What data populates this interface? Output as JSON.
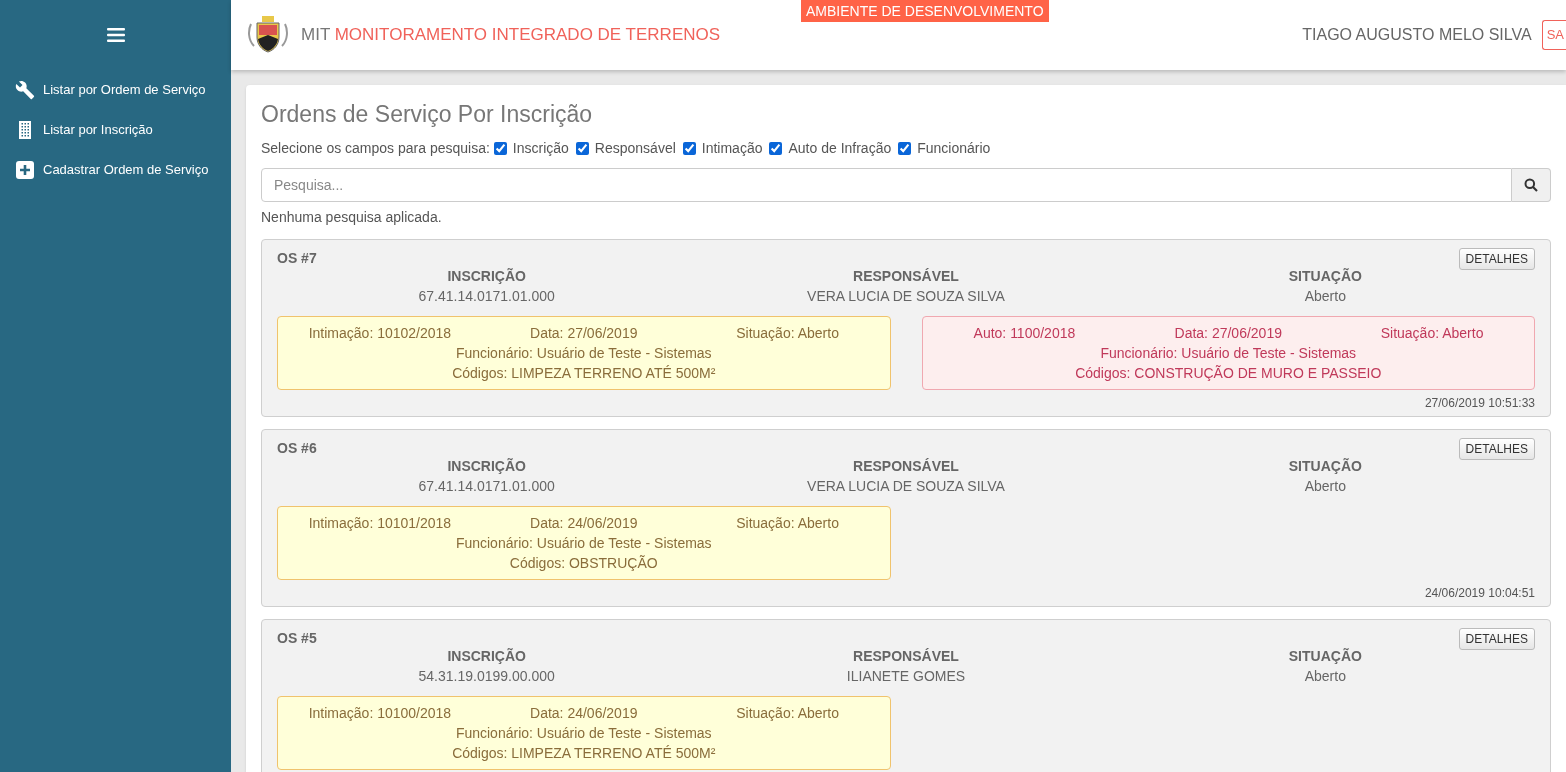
{
  "sidebar": {
    "items": [
      {
        "label": "Listar por Ordem de Serviço",
        "kind": "wrench"
      },
      {
        "label": "Listar por Inscrição",
        "kind": "building"
      },
      {
        "label": "Cadastrar Ordem de Serviço",
        "kind": "plus"
      }
    ]
  },
  "header": {
    "app_short": "MIT",
    "app_name": "MONITORAMENTO INTEGRADO DE TERRENOS",
    "environment": "AMBIENTE DE DESENVOLVIMENTO",
    "user": "TIAGO AUGUSTO MELO SILVA",
    "logout": "SA"
  },
  "page": {
    "title": "Ordens de Serviço Por Inscrição",
    "fields_label": "Selecione os campos para pesquisa:",
    "fields": [
      {
        "label": "Inscrição",
        "checked": true
      },
      {
        "label": "Responsável",
        "checked": true
      },
      {
        "label": "Intimação",
        "checked": true
      },
      {
        "label": "Auto de Infração",
        "checked": true
      },
      {
        "label": "Funcionário",
        "checked": true
      }
    ],
    "search": {
      "placeholder": "Pesquisa..."
    },
    "status": "Nenhuma pesquisa aplicada."
  },
  "orders": [
    {
      "title": "OS #7",
      "button": "DETALHES",
      "columns": [
        {
          "label": "INSCRIÇÃO",
          "value": "67.41.14.0171.01.000"
        },
        {
          "label": "RESPONSÁVEL",
          "value": "VERA LUCIA DE SOUZA SILVA"
        },
        {
          "label": "SITUAÇÃO",
          "value": "Aberto"
        }
      ],
      "notices": [
        {
          "kind": "intimacao",
          "number": "Intimação: 10102/2018",
          "date": "Data: 27/06/2019",
          "status": "Situação: Aberto",
          "employee": "Funcionário: Usuário de Teste - Sistemas",
          "codes": "Códigos: LIMPEZA TERRENO ATÉ 500M²"
        },
        {
          "kind": "auto",
          "number": "Auto: 1100/2018",
          "date": "Data: 27/06/2019",
          "status": "Situação: Aberto",
          "employee": "Funcionário: Usuário de Teste - Sistemas",
          "codes": "Códigos: CONSTRUÇÃO DE MURO E PASSEIO"
        }
      ],
      "timestamp": "27/06/2019 10:51:33"
    },
    {
      "title": "OS #6",
      "button": "DETALHES",
      "columns": [
        {
          "label": "INSCRIÇÃO",
          "value": "67.41.14.0171.01.000"
        },
        {
          "label": "RESPONSÁVEL",
          "value": "VERA LUCIA DE SOUZA SILVA"
        },
        {
          "label": "SITUAÇÃO",
          "value": "Aberto"
        }
      ],
      "notices": [
        {
          "kind": "intimacao",
          "number": "Intimação: 10101/2018",
          "date": "Data: 24/06/2019",
          "status": "Situação: Aberto",
          "employee": "Funcionário: Usuário de Teste - Sistemas",
          "codes": "Códigos: OBSTRUÇÃO"
        }
      ],
      "timestamp": "24/06/2019 10:04:51"
    },
    {
      "title": "OS #5",
      "button": "DETALHES",
      "columns": [
        {
          "label": "INSCRIÇÃO",
          "value": "54.31.19.0199.00.000"
        },
        {
          "label": "RESPONSÁVEL",
          "value": "ILIANETE GOMES"
        },
        {
          "label": "SITUAÇÃO",
          "value": "Aberto"
        }
      ],
      "notices": [
        {
          "kind": "intimacao",
          "number": "Intimação: 10100/2018",
          "date": "Data: 24/06/2019",
          "status": "Situação: Aberto",
          "employee": "Funcionário: Usuário de Teste - Sistemas",
          "codes": "Códigos: LIMPEZA TERRENO ATÉ 500M²"
        }
      ]
    }
  ]
}
